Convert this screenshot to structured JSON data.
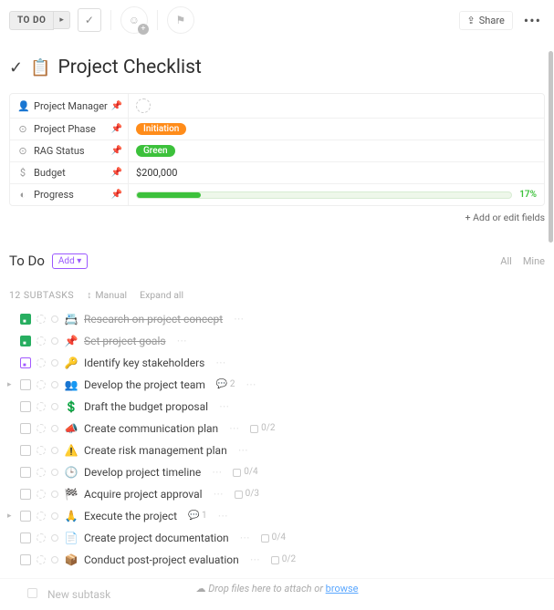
{
  "topbar": {
    "status": "TO DO",
    "share": "Share"
  },
  "title": "Project Checklist",
  "fields": [
    {
      "icon": "👤",
      "label": "Project Manager",
      "type": "person"
    },
    {
      "icon": "⊙",
      "label": "Project Phase",
      "type": "tag",
      "tag_class": "orange",
      "value": "Initiation"
    },
    {
      "icon": "⊙",
      "label": "RAG Status",
      "type": "tag",
      "tag_class": "green",
      "value": "Green"
    },
    {
      "icon": "$",
      "label": "Budget",
      "type": "text",
      "value": "$200,000"
    },
    {
      "icon": "◐",
      "label": "Progress",
      "type": "progress",
      "pct": 17,
      "pct_label": "17%"
    }
  ],
  "add_fields_label": "+ Add or edit fields",
  "section": {
    "title": "To Do",
    "add": "Add ▾",
    "filter_all": "All",
    "filter_mine": "Mine"
  },
  "subtasks_header": {
    "count_label": "12 SUBTASKS",
    "sort": "Manual",
    "expand": "Expand all"
  },
  "tasks": [
    {
      "status": "done",
      "emoji": "📇",
      "title": "Research on project concept",
      "strike": true
    },
    {
      "status": "done",
      "emoji": "📌",
      "title": "Set project goals",
      "strike": true
    },
    {
      "status": "purple",
      "emoji": "🔑",
      "title": "Identify key stakeholders"
    },
    {
      "status": "open",
      "emoji": "👥",
      "title": "Develop the project team",
      "twist": true,
      "comments": "2"
    },
    {
      "status": "open",
      "emoji": "💲",
      "title": "Draft the budget proposal"
    },
    {
      "status": "open",
      "emoji": "📣",
      "title": "Create communication plan",
      "checklist": "0/2"
    },
    {
      "status": "open",
      "emoji": "⚠️",
      "title": "Create risk management plan"
    },
    {
      "status": "open",
      "emoji": "🕒",
      "title": "Develop project timeline",
      "checklist": "0/4"
    },
    {
      "status": "open",
      "emoji": "🏁",
      "title": "Acquire project approval",
      "checklist": "0/3"
    },
    {
      "status": "open",
      "emoji": "🙏",
      "title": "Execute the project",
      "twist": true,
      "comments": "1"
    },
    {
      "status": "open",
      "emoji": "📄",
      "title": "Create project documentation",
      "checklist": "0/4"
    },
    {
      "status": "open",
      "emoji": "📦",
      "title": "Conduct post-project evaluation",
      "checklist": "0/2"
    }
  ],
  "new_subtask": "New subtask",
  "dropzone": {
    "text": "Drop files here to attach or ",
    "link": "browse"
  }
}
